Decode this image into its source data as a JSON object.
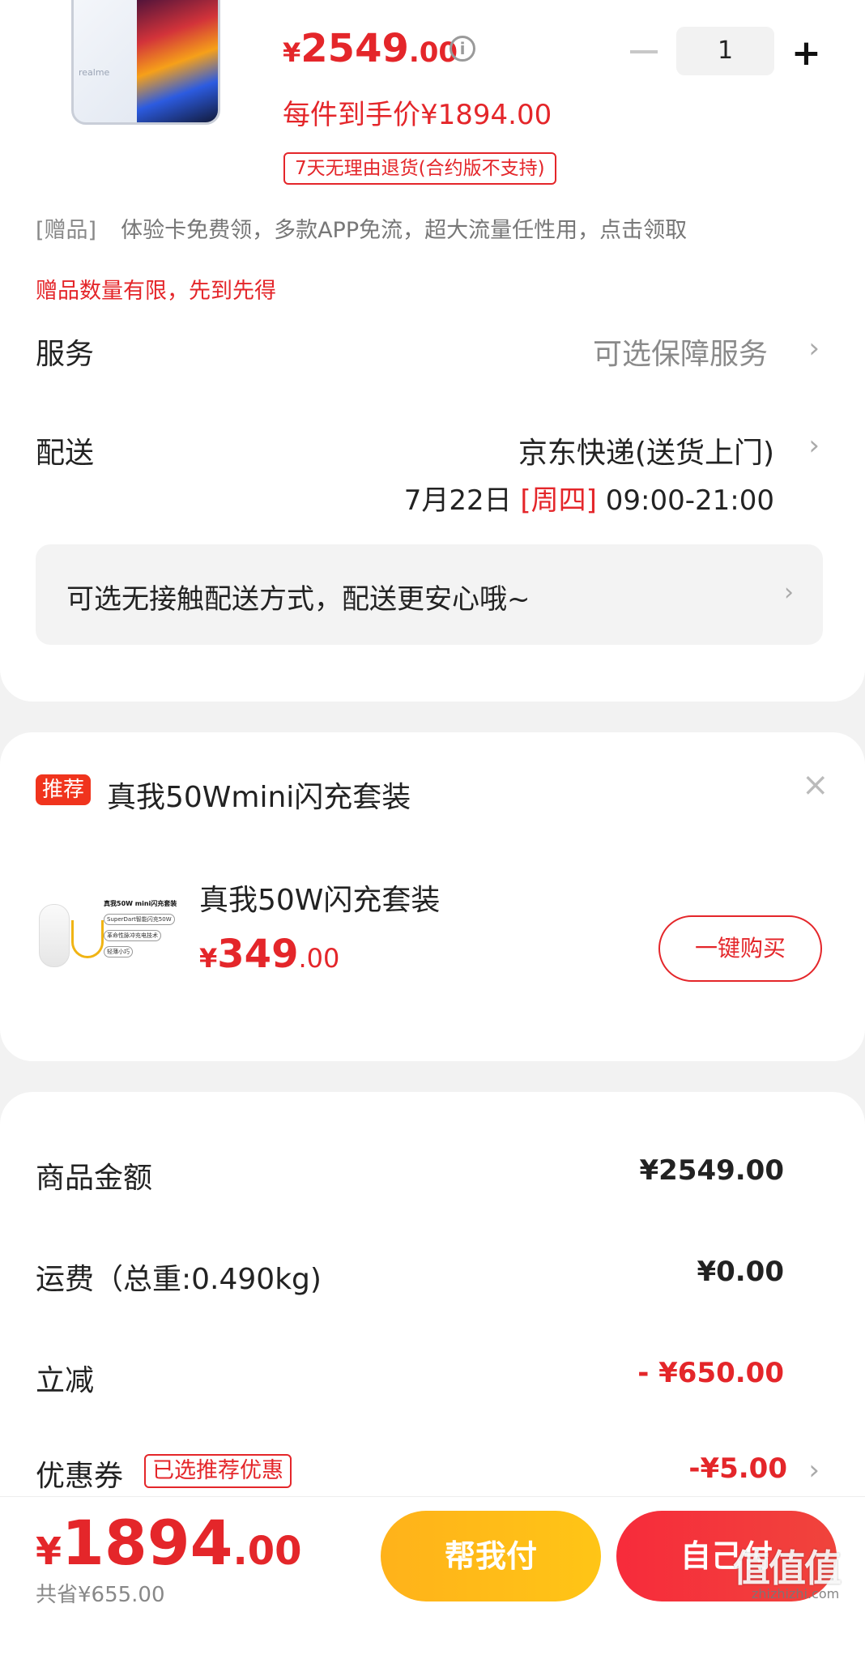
{
  "product": {
    "image_brand": "realme",
    "price_yen": "¥",
    "price_int": "2549",
    "price_dec": ".00",
    "info_glyph": "i",
    "final_price": "每件到手价¥1894.00",
    "quantity": "1",
    "qty_minus": "−",
    "qty_plus": "+",
    "return_policy": "7天无理由退货(合约版不支持)",
    "gift_tag": "[赠品]",
    "gift_text": "体验卡免费领，多款APP免流，超大流量任性用，点击领取",
    "gift_limit": "赠品数量有限，先到先得"
  },
  "service": {
    "label": "服务",
    "value": "可选保障服务"
  },
  "delivery": {
    "label": "配送",
    "method": "京东快递(送货上门)",
    "date": "7月22日",
    "weekday": "[周四]",
    "time": "09:00-21:00"
  },
  "contactless": {
    "text": "可选无接触配送方式，配送更安心哦~"
  },
  "recommendation": {
    "tag": "推荐",
    "title": "真我50Wmini闪充套装",
    "close": "×",
    "item_name": "真我50W闪充套装",
    "price_yen": "¥",
    "price_int": "349",
    "price_dec": ".00",
    "buy_label": "一键购买",
    "image_text": {
      "head": "真我50W mini闪充套装",
      "line1": "SuperDart智能闪充50W",
      "line2": "革命性脉冲充电技术",
      "line3": "轻薄小巧"
    }
  },
  "summary": {
    "goods_label": "商品金额",
    "goods_value": "¥2549.00",
    "shipping_label": "运费（总重:0.490kg)",
    "shipping_value": "¥0.00",
    "discount_label": "立减",
    "discount_value": "- ¥650.00",
    "coupon_label": "优惠券",
    "coupon_tag": "已选推荐优惠",
    "coupon_value": "-¥5.00"
  },
  "bottom": {
    "total_yen": "¥",
    "total_int": "1894",
    "total_dec": ".00",
    "saved": "共省¥655.00",
    "help_pay": "帮我付",
    "self_pay": "自己付"
  },
  "watermark": {
    "logo": "值值值",
    "url": "zhizhizhi.com"
  },
  "icons": {
    "chevron": "›"
  },
  "colors": {
    "accent_red": "#e4262a",
    "button_yellow": "#ffb21a",
    "button_red": "#f72b3b"
  }
}
